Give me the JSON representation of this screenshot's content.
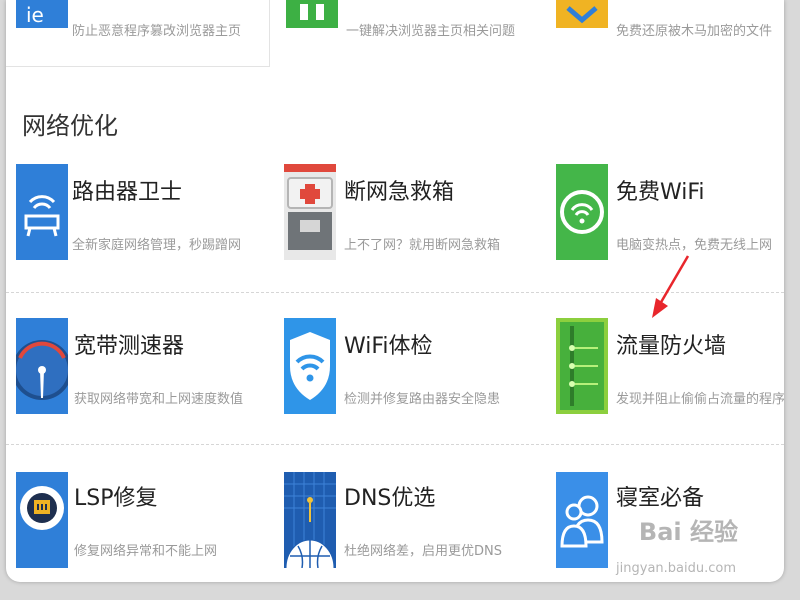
{
  "top_row": [
    {
      "desc": "防止恶意程序篡改浏览器主页",
      "icon": "shield-ie-icon",
      "color": "#2f7fd8"
    },
    {
      "desc": "一键解决浏览器主页相关问题",
      "icon": "homepage-fix-icon",
      "color": "#3db044"
    },
    {
      "desc": "免费还原被木马加密的文件",
      "icon": "file-restore-icon",
      "color": "#f0b323"
    }
  ],
  "section_title": "网络优化",
  "tools": [
    {
      "title": "路由器卫士",
      "desc": "全新家庭网络管理，秒踢蹭网",
      "icon": "router-icon",
      "color": "#2f7fd8"
    },
    {
      "title": "断网急救箱",
      "desc": "上不了网？就用断网急救箱",
      "icon": "first-aid-kit-icon",
      "color": "#e0483c"
    },
    {
      "title": "免费WiFi",
      "desc": "电脑变热点，免费无线上网",
      "icon": "free-wifi-icon",
      "color": "#44b649"
    },
    {
      "title": "宽带测速器",
      "desc": "获取网络带宽和上网速度数值",
      "icon": "speedometer-icon",
      "color": "#2f7fd8"
    },
    {
      "title": "WiFi体检",
      "desc": "检测并修复路由器安全隐患",
      "icon": "wifi-shield-icon",
      "color": "#2f95e8"
    },
    {
      "title": "流量防火墙",
      "desc": "发现并阻止偷偷占流量的程序",
      "icon": "traffic-firewall-icon",
      "color": "#47b03c"
    },
    {
      "title": "LSP修复",
      "desc": "修复网络异常和不能上网",
      "icon": "lsp-repair-icon",
      "color": "#2f7fd8"
    },
    {
      "title": "DNS优选",
      "desc": "杜绝网络差，启用更优DNS",
      "icon": "dns-globe-icon",
      "color": "#1f5db0"
    },
    {
      "title": "寝室必备",
      "desc": "",
      "icon": "dorm-users-icon",
      "color": "#3a8fe8"
    }
  ],
  "watermark": {
    "logo": "Bai 经验",
    "url": "jingyan.baidu.com"
  },
  "accent_arrow_color": "#e8262c"
}
